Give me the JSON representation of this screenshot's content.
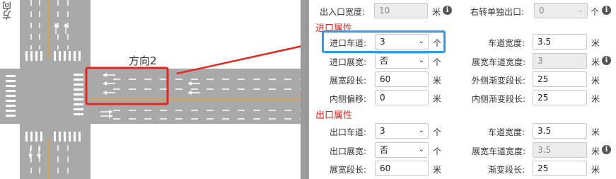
{
  "map": {
    "direction_label": "方向2",
    "side_label": "方向"
  },
  "colors": {
    "road": "#a9a9a9",
    "lane_center": "#d6a14a",
    "highlight_red": "#e5261e",
    "highlight_blue": "#2d9cf0",
    "section_title": "#e0201c"
  },
  "form": {
    "top_row": {
      "entrance_width_label": "出入口宽度:",
      "entrance_width_value": "10",
      "entrance_width_unit": "米",
      "right_turn_label": "右转单独出口:",
      "right_turn_value": "0",
      "right_turn_unit": "个"
    },
    "entrance_section_title": "进口属性",
    "entrance": {
      "lanes_label": "进口车道:",
      "lanes_value": "3",
      "lanes_unit": "个",
      "lane_width_label": "车道宽度:",
      "lane_width_value": "3.5",
      "lane_width_unit": "米",
      "widen_label": "进口展宽:",
      "widen_value": "否",
      "widen_unit": "个",
      "widen_lane_width_label": "展宽车道宽度:",
      "widen_lane_width_value": "3",
      "widen_lane_width_unit": "米",
      "widen_length_label": "展宽段长:",
      "widen_length_value": "60",
      "widen_length_unit": "米",
      "outer_taper_label": "外侧渐变段长:",
      "outer_taper_value": "25",
      "outer_taper_unit": "米",
      "inner_offset_label": "内侧偏移:",
      "inner_offset_value": "0",
      "inner_offset_unit": "米",
      "inner_taper_label": "内侧渐变段长:",
      "inner_taper_value": "25",
      "inner_taper_unit": "米"
    },
    "exit_section_title": "出口属性",
    "exit": {
      "lanes_label": "出口车道:",
      "lanes_value": "3",
      "lanes_unit": "个",
      "lane_width_label": "车道宽度:",
      "lane_width_value": "3.5",
      "lane_width_unit": "米",
      "widen_label": "出口展宽:",
      "widen_value": "否",
      "widen_unit": "个",
      "widen_lane_width_label": "展宽车道宽度:",
      "widen_lane_width_value": "3.5",
      "widen_lane_width_unit": "米",
      "widen_length_label": "展宽段长:",
      "widen_length_value": "60",
      "widen_length_unit": "米",
      "taper_label": "渐变段长:",
      "taper_value": "25",
      "taper_unit": "米"
    }
  }
}
